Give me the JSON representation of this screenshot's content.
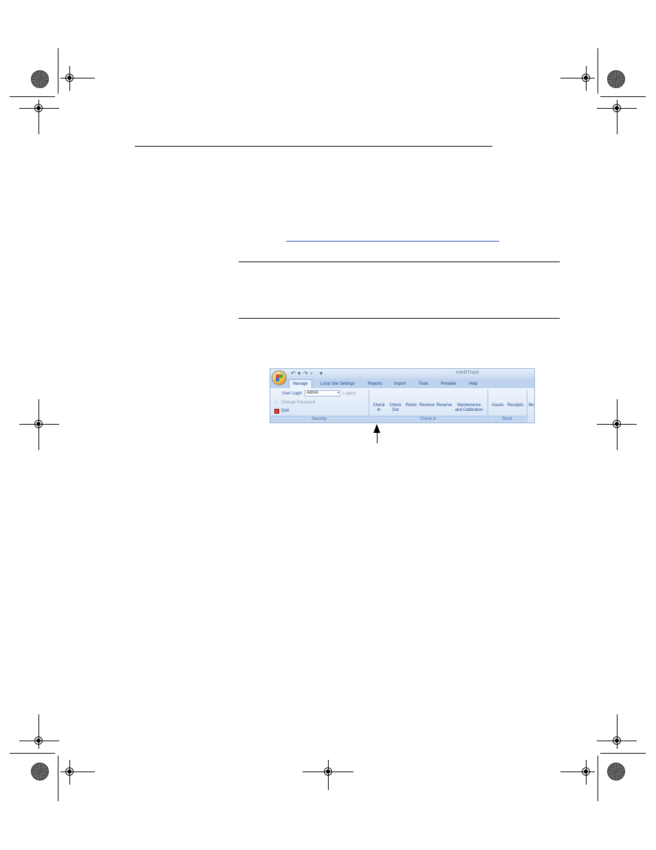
{
  "ribbon": {
    "app_title": "IntelliTrack",
    "qat": {
      "undo": "↶",
      "redo": "↷",
      "dropdown": "▾"
    },
    "tabs": [
      "Manage",
      "Local Site Settings",
      "Reports",
      "Import",
      "Tools",
      "Portable",
      "Help"
    ],
    "security": {
      "user_login_label": "User Login",
      "user_value": "Admin",
      "logout": "Logout",
      "change_password": "Change Password",
      "quit": "Quit",
      "group_label": "Security"
    },
    "check_in": {
      "buttons": [
        {
          "line1": "Check",
          "line2": "In"
        },
        {
          "line1": "Check",
          "line2": "Out"
        },
        {
          "line1": "Retire",
          "line2": ""
        },
        {
          "line1": "Receive",
          "line2": ""
        },
        {
          "line1": "Reserve",
          "line2": ""
        },
        {
          "line1": "Maintenance",
          "line2": "and Calibration"
        }
      ],
      "group_label": "Check In"
    },
    "stock": {
      "buttons": [
        "Issues",
        "Receipts"
      ],
      "group_label": "Stock"
    },
    "cut_off_label": "Be"
  }
}
